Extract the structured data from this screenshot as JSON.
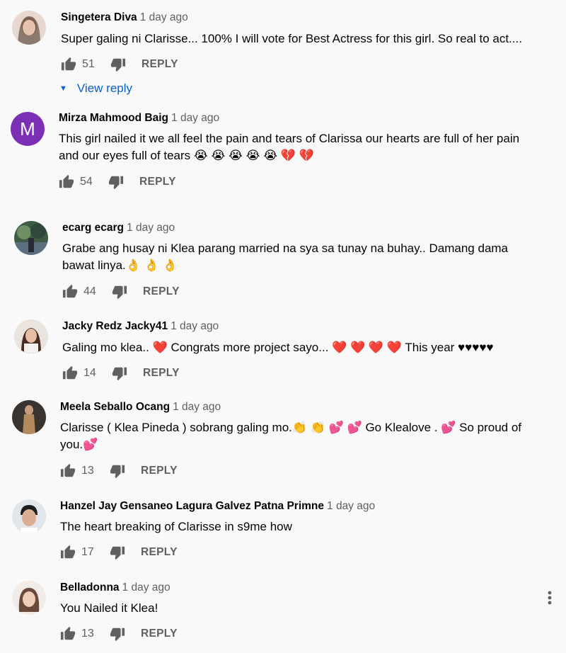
{
  "comments": [
    {
      "author": "Singetera Diva",
      "time": "1 day ago",
      "text": "Super galing ni Clarisse... 100% I will vote for Best Actress for this girl. So real to act....",
      "likes": "51",
      "reply": "REPLY",
      "avatar": "photo",
      "view_reply": "View reply"
    },
    {
      "author": "Mirza Mahmood Baig",
      "time": "1 day ago",
      "text": "This girl nailed it we all feel the pain and tears of Clarissa our hearts  are full of her pain and our eyes full of tears 😭 😭 😭 😭 😭 💔 💔",
      "likes": "54",
      "reply": "REPLY",
      "avatar": "M"
    },
    {
      "author": "ecarg ecarg",
      "time": "1 day ago",
      "text": "Grabe ang husay ni Klea parang married na sya sa tunay na buhay.. Damang dama bawat linya.👌 👌 👌",
      "likes": "44",
      "reply": "REPLY",
      "avatar": "photo"
    },
    {
      "author": "Jacky Redz Jacky41",
      "time": "1 day ago",
      "text": "Galing mo klea.. ❤️ Congrats more project sayo... ❤️ ❤️ ❤️ ❤️ This year ♥♥♥♥♥",
      "likes": "14",
      "reply": "REPLY",
      "avatar": "photo"
    },
    {
      "author": "Meela Seballo Ocang",
      "time": "1 day ago",
      "text": "Clarisse ( Klea Pineda ) sobrang galing mo.👏 👏 💕 💕  Go Klealove . 💕  So proud of you.💕",
      "likes": "13",
      "reply": "REPLY",
      "avatar": "photo"
    },
    {
      "author": "Hanzel Jay Gensaneo Lagura Galvez Patna Primne",
      "time": "1 day ago",
      "text": "The heart breaking of Clarisse in s9me how",
      "likes": "17",
      "reply": "REPLY",
      "avatar": "photo"
    },
    {
      "author": "Belladonna",
      "time": "1 day ago",
      "text": "You Nailed it Klea!",
      "likes": "13",
      "reply": "REPLY",
      "avatar": "photo"
    }
  ],
  "colors": {
    "link": "#065fd4",
    "meta": "#606060",
    "avatar_letter_bg": "#7b2fb5"
  }
}
